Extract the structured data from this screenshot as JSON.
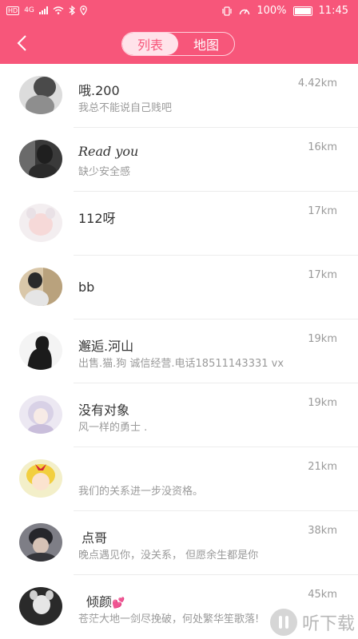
{
  "status_bar": {
    "network": "4G",
    "battery_percent": "100%",
    "time": "11:45",
    "battery_level": 1.0
  },
  "header": {
    "back_icon": "chevron-left-icon",
    "tabs": [
      {
        "label": "列表",
        "active": true
      },
      {
        "label": "地图",
        "active": false
      }
    ],
    "color": "#f7567a"
  },
  "users": [
    {
      "name": "哦.200",
      "signature": "我总不能说自己贱吧",
      "distance": "4.42km"
    },
    {
      "name": "Read you",
      "signature": "缺少安全感",
      "distance": "16km"
    },
    {
      "name": "112呀",
      "signature": "",
      "distance": "17km"
    },
    {
      "name": "bb",
      "signature": "",
      "distance": "17km"
    },
    {
      "name": "邂逅.河山",
      "signature": "出售.猫.狗  诚信经营.电话18511143331 vx",
      "distance": "19km"
    },
    {
      "name": "没有对象",
      "signature": "风一样的勇士 .",
      "distance": "19km"
    },
    {
      "name": "",
      "signature": "我们的关系进一步没资格。",
      "distance": "21km"
    },
    {
      "name": "点哥",
      "signature": "晚点遇见你，没关系， 但愿余生都是你",
      "distance": "38km"
    },
    {
      "name": "倾颜",
      "signature": "苍茫大地一剑尽挽破，何处繁华笙歌落!",
      "distance": "45km"
    }
  ],
  "watermark": {
    "text": "听下载"
  }
}
